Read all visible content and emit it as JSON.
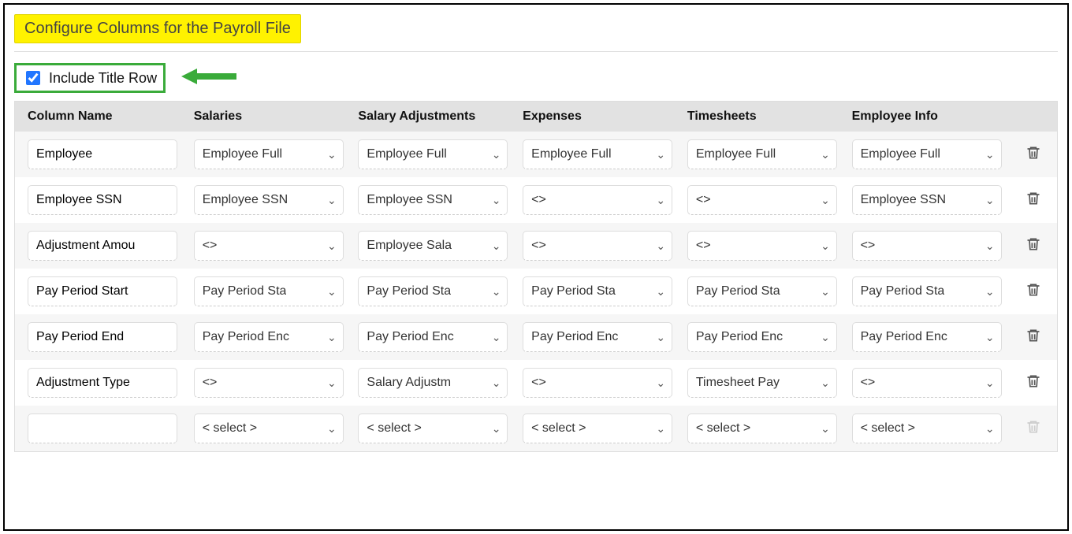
{
  "title": "Configure Columns for the Payroll File",
  "include_title_row": {
    "label": "Include Title Row",
    "checked": true
  },
  "headers": {
    "column_name": "Column Name",
    "salaries": "Salaries",
    "salary_adjustments": "Salary Adjustments",
    "expenses": "Expenses",
    "timesheets": "Timesheets",
    "employee_info": "Employee Info"
  },
  "rows": [
    {
      "name": "Employee",
      "salaries": "Employee Full",
      "salary_adjustments": "Employee Full",
      "expenses": "Employee Full",
      "timesheets": "Employee Full",
      "employee_info": "Employee Full",
      "deletable": true
    },
    {
      "name": "Employee SSN",
      "salaries": "Employee SSN",
      "salary_adjustments": "Employee SSN",
      "expenses": "<<ignore>>",
      "timesheets": "<<ignore>>",
      "employee_info": "Employee SSN",
      "deletable": true
    },
    {
      "name": "Adjustment Amou",
      "salaries": "<<ignore>>",
      "salary_adjustments": "Employee Sala",
      "expenses": "<<ignore>>",
      "timesheets": "<<ignore>>",
      "employee_info": "<<ignore>>",
      "deletable": true
    },
    {
      "name": "Pay Period Start",
      "salaries": "Pay Period Sta",
      "salary_adjustments": "Pay Period Sta",
      "expenses": "Pay Period Sta",
      "timesheets": "Pay Period Sta",
      "employee_info": "Pay Period Sta",
      "deletable": true
    },
    {
      "name": "Pay Period End",
      "salaries": "Pay Period Enc",
      "salary_adjustments": "Pay Period Enc",
      "expenses": "Pay Period Enc",
      "timesheets": "Pay Period Enc",
      "employee_info": "Pay Period Enc",
      "deletable": true
    },
    {
      "name": "Adjustment Type",
      "salaries": "<<ignore>>",
      "salary_adjustments": "Salary Adjustm",
      "expenses": "<<ignore>>",
      "timesheets": "Timesheet Pay",
      "employee_info": "<<ignore>>",
      "deletable": true
    },
    {
      "name": "",
      "salaries": "< select >",
      "salary_adjustments": "< select >",
      "expenses": "< select >",
      "timesheets": "< select >",
      "employee_info": "< select >",
      "deletable": false
    }
  ]
}
